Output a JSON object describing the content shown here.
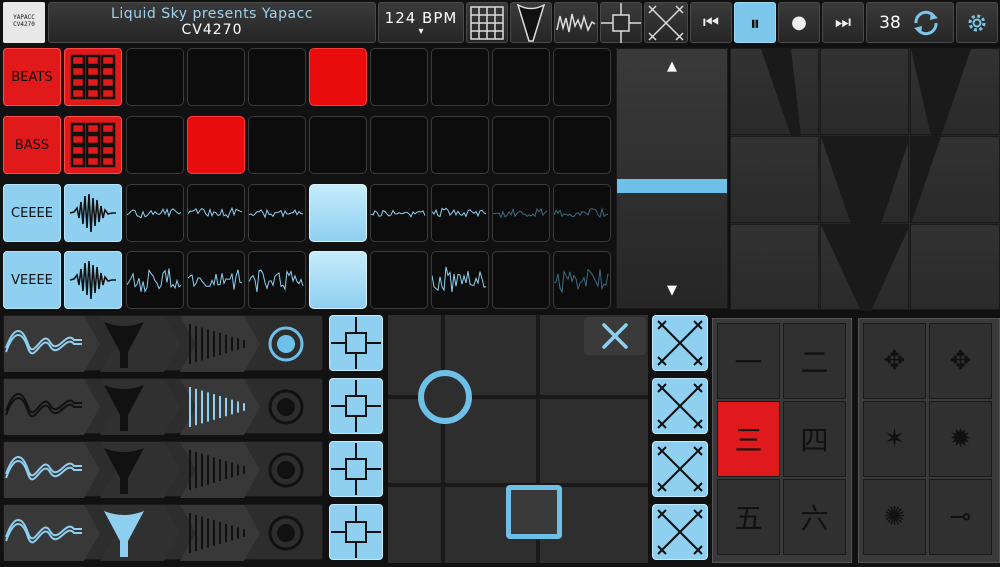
{
  "header": {
    "logo_text": "YAPACC CV4270",
    "line1": "Liquid Sky presents Yapacc",
    "line2": "CV4270",
    "bpm": "124 BPM",
    "bpm_arrow": "▾",
    "bar_count": "38",
    "transport": {
      "prev": "⏮",
      "pause": "⏸",
      "record": "●",
      "next": "⏭"
    }
  },
  "tracks": [
    {
      "name": "BEATS",
      "color": "red"
    },
    {
      "name": "BASS",
      "color": "red"
    },
    {
      "name": "CEEEE",
      "color": "blue"
    },
    {
      "name": "VEEEE",
      "color": "blue"
    }
  ],
  "volume": {
    "up": "▲",
    "down": "▼",
    "level": 0.55
  },
  "kanji_pad": [
    "一",
    "二",
    "三",
    "四",
    "五",
    "六"
  ],
  "shuriken_pad": [
    "✥",
    "✥",
    "✶",
    "✹",
    "✺",
    "⊸"
  ],
  "colors": {
    "accent_red": "#e01a1a",
    "accent_blue": "#8fd0f0"
  }
}
